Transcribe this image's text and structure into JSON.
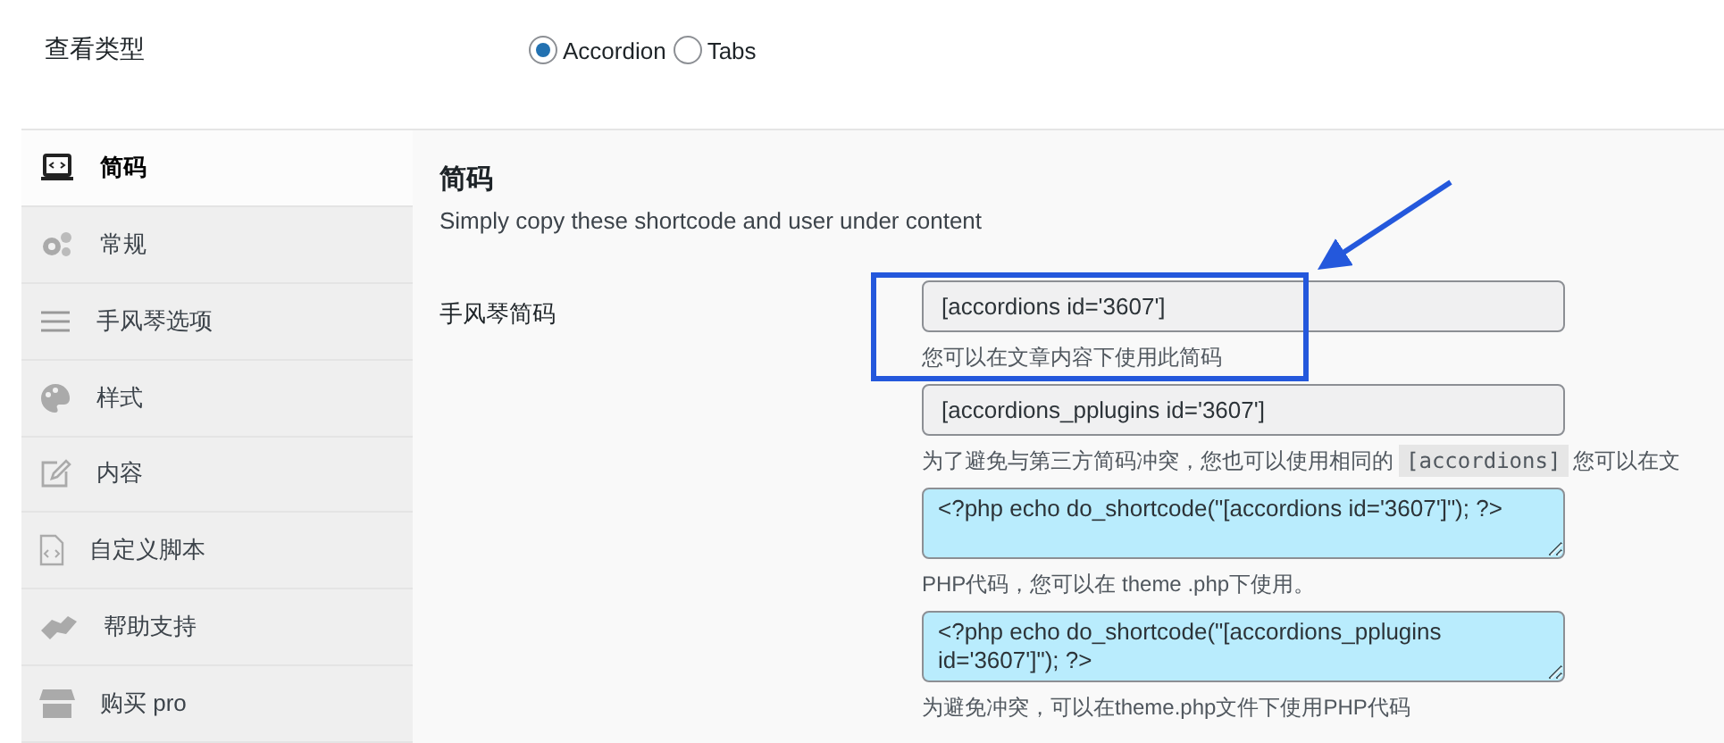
{
  "view_type": {
    "label": "查看类型",
    "options": [
      {
        "label": "Accordion",
        "selected": true
      },
      {
        "label": "Tabs",
        "selected": false
      }
    ]
  },
  "sidebar": {
    "items": [
      {
        "label": "简码",
        "selected": true
      },
      {
        "label": "常规",
        "selected": false
      },
      {
        "label": "手风琴选项",
        "selected": false
      },
      {
        "label": "样式",
        "selected": false
      },
      {
        "label": "内容",
        "selected": false
      },
      {
        "label": "自定义脚本",
        "selected": false
      },
      {
        "label": "帮助支持",
        "selected": false
      },
      {
        "label": "购买 pro",
        "selected": false
      }
    ]
  },
  "section": {
    "title": "简码",
    "description": "Simply copy these shortcode and user under content"
  },
  "shortcode_row": {
    "label": "手风琴简码",
    "fields": [
      {
        "kind": "input",
        "value": "[accordions id='3607']",
        "hint": {
          "text": "您可以在文章内容下使用此简码"
        }
      },
      {
        "kind": "input",
        "value": "[accordions_pplugins id='3607']",
        "hint": {
          "text": "为了避免与第三方简码冲突，您也可以使用相同的",
          "code": "[accordions]",
          "after": "您可以在文"
        }
      },
      {
        "kind": "textarea",
        "value": "<?php echo do_shortcode(\"[accordions id='3607']\"); ?>",
        "hint": {
          "text": "PHP代码，您可以在 theme .php下使用。"
        }
      },
      {
        "kind": "textarea",
        "value": "<?php echo do_shortcode(\"[accordions_pplugins id='3607']\"); ?>",
        "hint": {
          "text": "为避免冲突，可以在theme.php文件下使用PHP代码"
        }
      }
    ]
  }
}
